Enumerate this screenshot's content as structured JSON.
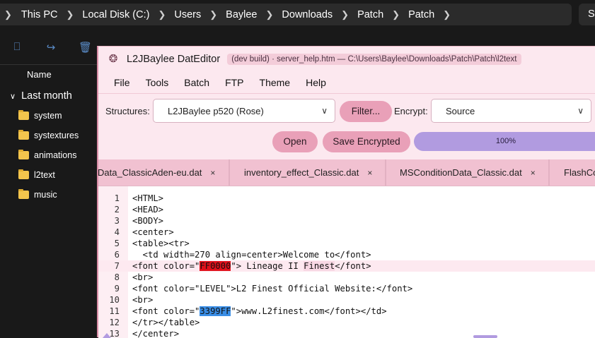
{
  "explorer": {
    "breadcrumbs": [
      "This PC",
      "Local Disk (C:)",
      "Users",
      "Baylee",
      "Downloads",
      "Patch",
      "Patch"
    ],
    "search_text": "Se",
    "column_header": "Name",
    "group_label": "Last month",
    "folders": [
      "system",
      "systextures",
      "animations",
      "l2text",
      "music"
    ]
  },
  "app": {
    "title": "L2JBaylee DatEditor",
    "build_info": "(dev build)  ·  server_help.htm  —  C:\\Users\\Baylee\\Downloads\\Patch\\Patch\\l2text",
    "menu": [
      "File",
      "Tools",
      "Batch",
      "FTP",
      "Theme",
      "Help"
    ],
    "structures_label": "Structures:",
    "structures_value": "L2JBaylee p520 (Rose)",
    "filter_button": "Filter...",
    "encrypt_label": "Encrypt:",
    "encrypt_value": "Source",
    "open_button": "Open",
    "save_button": "Save Encrypted",
    "progress_text": "100%",
    "progress_value": 100,
    "tabs": [
      {
        "label": "Data_ClassicAden-eu.dat",
        "close": "×"
      },
      {
        "label": "inventory_effect_Classic.dat",
        "close": "×"
      },
      {
        "label": "MSConditionData_Classic.dat",
        "close": "×"
      },
      {
        "label": "FlashCo",
        "close": ""
      }
    ],
    "code_lines": [
      {
        "n": "1",
        "t": "<HTML>"
      },
      {
        "n": "2",
        "t": "<HEAD>"
      },
      {
        "n": "3",
        "t": "<BODY>"
      },
      {
        "n": "4",
        "t": "<center>"
      },
      {
        "n": "5",
        "t": "<table><tr>"
      },
      {
        "n": "6",
        "t": "  <td width=270 align=center>Welcome to</font>"
      },
      {
        "n": "7",
        "a": "<font color=\"",
        "h": "FF0000",
        "b": "\"> Lineage II ",
        "w": "Finest",
        "c": "</font>"
      },
      {
        "n": "8",
        "t": "<br>"
      },
      {
        "n": "9",
        "t": "<font color=\"LEVEL\">L2 Finest Official Website:</font>"
      },
      {
        "n": "10",
        "t": "<br>"
      },
      {
        "n": "11",
        "a": "<font color=\"",
        "h": "3399FF",
        "b": "\">www.L2finest.com</font></td>"
      },
      {
        "n": "12",
        "t": "</tr></table>"
      },
      {
        "n": "13",
        "t": "</center>"
      }
    ]
  }
}
